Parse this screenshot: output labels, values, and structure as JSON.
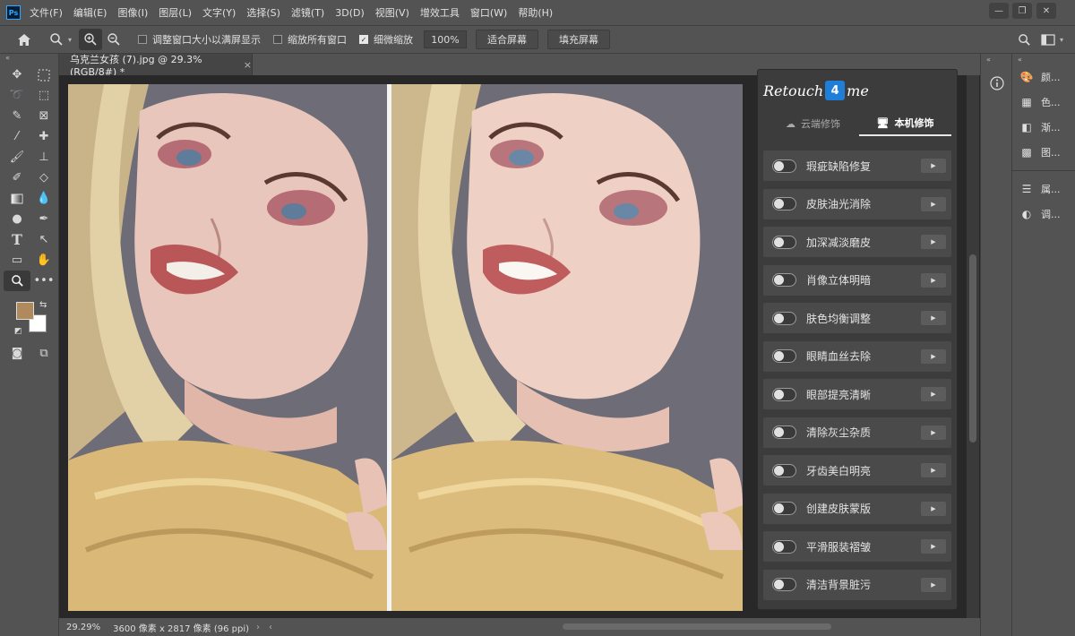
{
  "app": {
    "logo": "Ps"
  },
  "menu": [
    "文件(F)",
    "编辑(E)",
    "图像(I)",
    "图层(L)",
    "文字(Y)",
    "选择(S)",
    "滤镜(T)",
    "3D(D)",
    "视图(V)",
    "增效工具",
    "窗口(W)",
    "帮助(H)"
  ],
  "window_controls": {
    "minimize": "—",
    "restore": "❐",
    "close": "✕"
  },
  "options": {
    "resize_windows": "调整窗口大小以满屏显示",
    "zoom_all": "缩放所有窗口",
    "scrubby_zoom": "细微缩放",
    "zoom_value": "100%",
    "fit_screen": "适合屏幕",
    "fill_screen": "填充屏幕"
  },
  "document": {
    "tab_title": "乌克兰女孩 (7).jpg @ 29.3%(RGB/8#) *",
    "close": "×"
  },
  "status": {
    "zoom": "29.29%",
    "info": "3600 像素 x 2817 像素 (96 ppi)"
  },
  "plugin": {
    "brand_prefix": "Retouch",
    "brand_mark": "4",
    "brand_suffix": "me",
    "tabs": [
      "云端修饰",
      "本机修饰"
    ],
    "functions": [
      "瑕疵缺陷修复",
      "皮肤油光消除",
      "加深减淡磨皮",
      "肖像立体明暗",
      "肤色均衡调整",
      "眼睛血丝去除",
      "眼部提亮清晰",
      "清除灰尘杂质",
      "牙齿美白明亮",
      "创建皮肤蒙版",
      "平滑服装褶皱",
      "清洁背景脏污"
    ]
  },
  "panels": [
    "颜...",
    "色...",
    "渐...",
    "图...",
    "属...",
    "调..."
  ],
  "colors": {
    "foreground": "#b08a5c",
    "background": "#ffffff",
    "accent": "#1f7fd8"
  }
}
